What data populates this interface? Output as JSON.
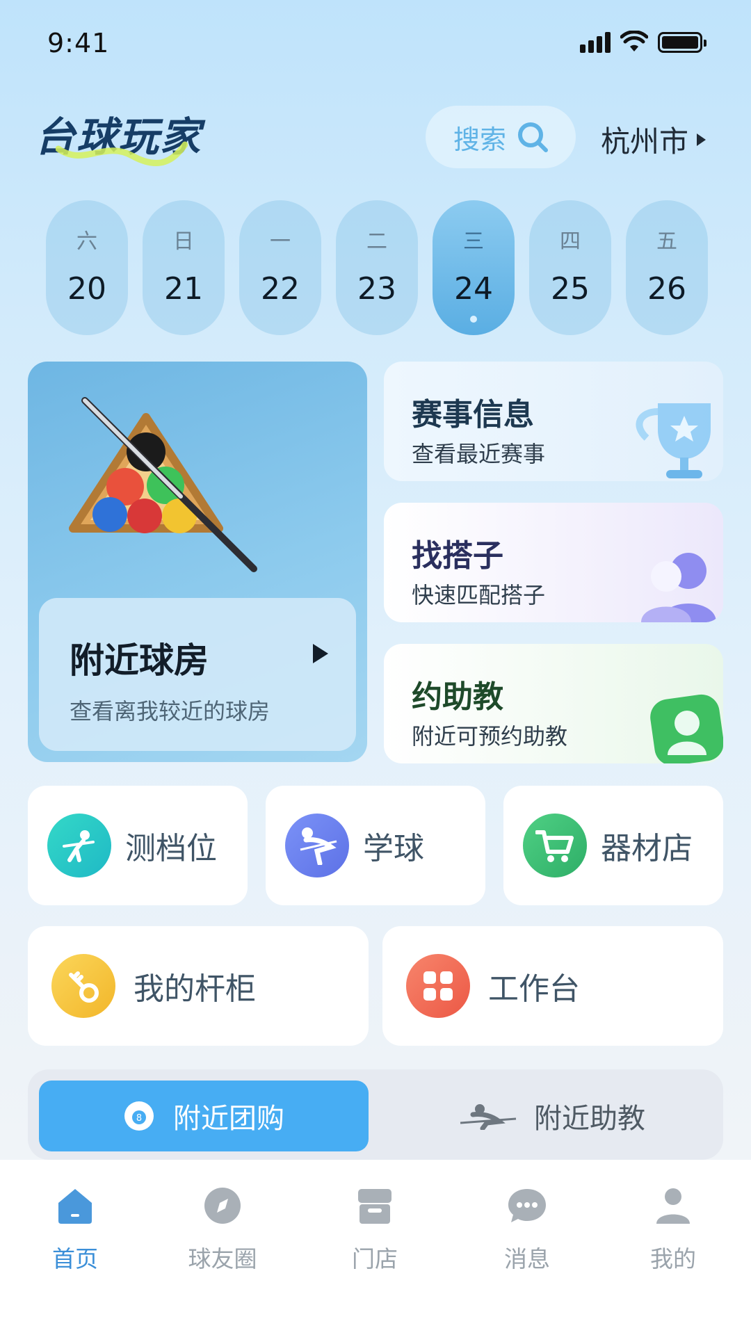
{
  "status_bar": {
    "time": "9:41"
  },
  "header": {
    "app_title": "台球玩家",
    "search_label": "搜索",
    "city": "杭州市"
  },
  "dates": [
    {
      "weekday": "六",
      "day": "20"
    },
    {
      "weekday": "日",
      "day": "21"
    },
    {
      "weekday": "一",
      "day": "22"
    },
    {
      "weekday": "二",
      "day": "23"
    },
    {
      "weekday": "三",
      "day": "24",
      "selected": true
    },
    {
      "weekday": "四",
      "day": "25"
    },
    {
      "weekday": "五",
      "day": "26"
    }
  ],
  "nearby_hall": {
    "title": "附近球房",
    "subtitle": "查看离我较近的球房"
  },
  "cards": {
    "events": {
      "title": "赛事信息",
      "subtitle": "查看最近赛事",
      "icon": "trophy-icon"
    },
    "partner": {
      "title": "找搭子",
      "subtitle": "快速匹配搭子",
      "icon": "people-icon"
    },
    "coach": {
      "title": "约助教",
      "subtitle": "附近可预约助教",
      "icon": "person-card-icon"
    }
  },
  "shortcuts": [
    {
      "label": "测档位",
      "icon": "billiard-player-icon",
      "color": "#2fd3c6"
    },
    {
      "label": "学球",
      "icon": "cue-stance-icon",
      "color": "#6f86f3"
    },
    {
      "label": "器材店",
      "icon": "cart-icon",
      "color": "#3fc17a"
    }
  ],
  "shortcuts2": [
    {
      "label": "我的杆柜",
      "icon": "key-icon",
      "color": "#f7c63f"
    },
    {
      "label": "工作台",
      "icon": "grid-icon",
      "color": "#f2705a"
    }
  ],
  "segment": {
    "active": "附近团购",
    "inactive": "附近助教"
  },
  "tabbar": [
    {
      "label": "首页",
      "icon": "home-icon",
      "active": true
    },
    {
      "label": "球友圈",
      "icon": "compass-icon"
    },
    {
      "label": "门店",
      "icon": "store-icon"
    },
    {
      "label": "消息",
      "icon": "chat-icon"
    },
    {
      "label": "我的",
      "icon": "user-icon"
    }
  ],
  "colors": {
    "accent": "#47adf3",
    "tab_active": "#3b8fd8",
    "tab_inactive": "#9aa3ab"
  }
}
